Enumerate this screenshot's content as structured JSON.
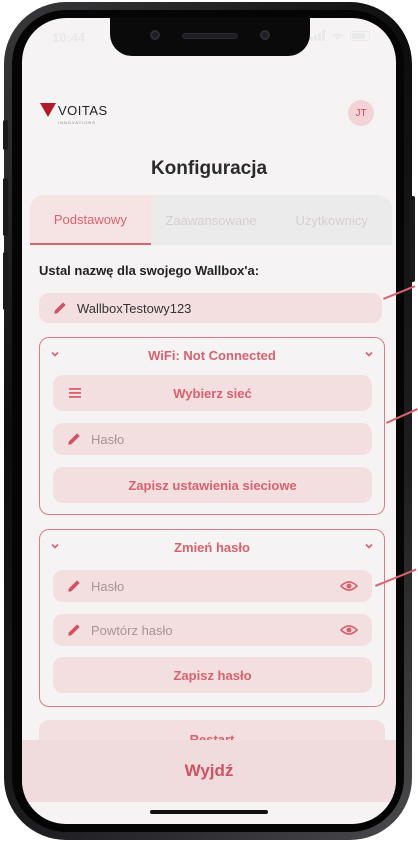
{
  "status_bar": {
    "time": "10:44"
  },
  "header": {
    "logo_text": "VOITAS",
    "logo_sub": "INNOVATIONS",
    "avatar_initials": "JT"
  },
  "page_title": "Konfiguracja",
  "tabs": [
    {
      "label": "Podstawowy",
      "active": true
    },
    {
      "label": "Zaawansowane",
      "active": false
    },
    {
      "label": "Użytkownicy",
      "active": false
    }
  ],
  "name_section": {
    "label": "Ustal nazwę dla swojego Wallbox'a:",
    "value": "WallboxTestowy123"
  },
  "wifi_card": {
    "title": "WiFi: Not Connected",
    "select_network_label": "Wybierz sieć",
    "password_placeholder": "Hasło",
    "save_label": "Zapisz ustawienia sieciowe"
  },
  "password_card": {
    "title": "Zmień hasło",
    "password_placeholder": "Hasło",
    "repeat_placeholder": "Powtórz hasło",
    "save_label": "Zapisz hasło"
  },
  "restart_label": "Restart",
  "exit_label": "Wyjdź",
  "colors": {
    "accent": "#d8616e",
    "field_bg": "#f4dfe0",
    "brand": "#b01a2a"
  },
  "icons": [
    "pencil-icon",
    "menu-icon",
    "eye-icon",
    "chevron-down-icon"
  ]
}
